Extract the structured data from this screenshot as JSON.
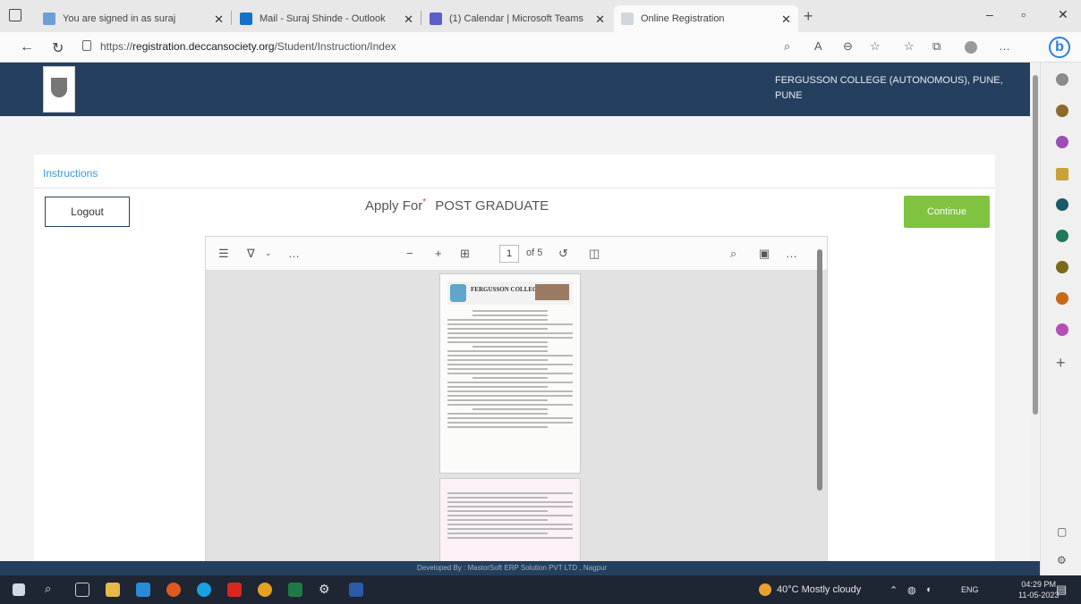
{
  "browser": {
    "tabs": [
      {
        "title": "You are signed in as suraj",
        "color": "#6aa0d6"
      },
      {
        "title": "Mail - Suraj Shinde - Outlook",
        "color": "#1470c8"
      },
      {
        "title": "(1) Calendar | Microsoft Teams",
        "color": "#5b5fc7"
      },
      {
        "title": "Online Registration",
        "color": "#d0d6dc"
      }
    ],
    "url_prefix": "https://",
    "url_domain": "registration.deccansociety.org",
    "url_path": "/Student/Instruction/Index",
    "window_controls": {
      "minimize": "–",
      "restore": "▫",
      "close": "✕"
    }
  },
  "site": {
    "college_name": "FERGUSSON COLLEGE (AUTONOMOUS), PUNE, PUNE",
    "section_title": "Instructions",
    "logout_label": "Logout",
    "apply_label": "Apply For",
    "apply_required_mark": "*",
    "apply_value": "POST GRADUATE",
    "continue_label": "Continue",
    "footer_text": "Developed By : MastorSoft ERP Solution PVT LTD , Nagpur"
  },
  "pdf_viewer": {
    "page_current": "1",
    "page_total": "of 5",
    "doc_heading": "FERGUSSON COLLEGE"
  },
  "taskbar": {
    "weather": "40°C  Mostly cloudy",
    "language": "ENG",
    "time": "04:29 PM",
    "date": "11-05-2023"
  },
  "colors": {
    "header": "#24405e",
    "continue": "#7fc341",
    "link": "#3a9ad8",
    "sidebar_dots": [
      "#8a8a8a",
      "#8d6a2a",
      "#9c4fb3",
      "#1a5a6a",
      "#1e7a5a",
      "#7a6a1a",
      "#c86a1a",
      "#b44fb8"
    ]
  }
}
